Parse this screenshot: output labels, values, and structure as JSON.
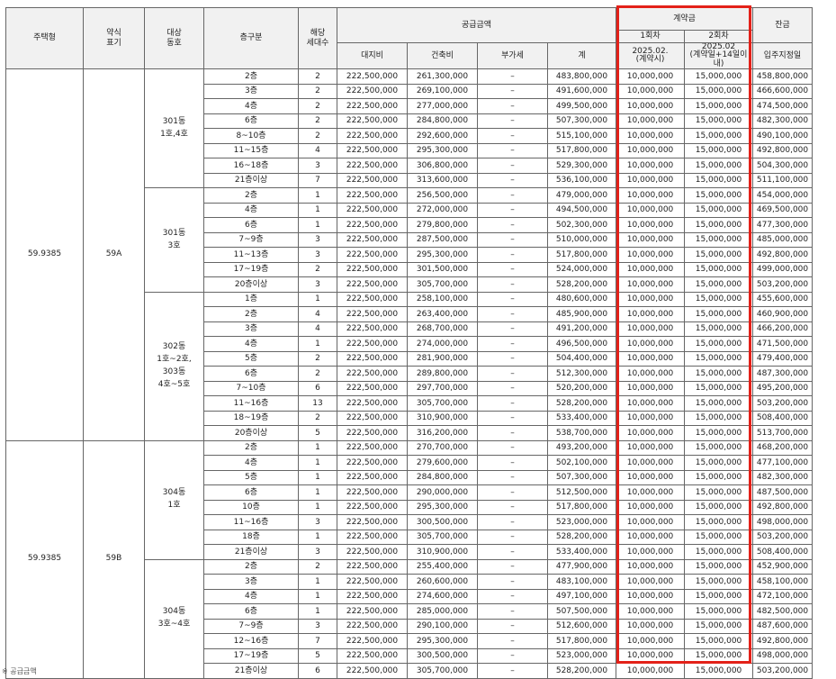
{
  "header": {
    "type": "주택형",
    "short": "약식\n표기",
    "dong": "대상\n동호",
    "floor": "층구분",
    "units": "해당\n세대수",
    "supply_group": "공급금액",
    "land": "대지비",
    "building": "건축비",
    "vat": "부가세",
    "total": "계",
    "deposit_group": "계약금",
    "dep1": "1회차",
    "dep1_date": "2025.02.\n(계약시)",
    "dep2": "2회차",
    "dep2_date": "2025.02\n(계약일+14일이내)",
    "balance": "잔금",
    "balance_date": "입주지정일"
  },
  "groups": [
    {
      "type": "59.9385",
      "short": "59A",
      "blocks": [
        {
          "dong": "301동\n1호,4호",
          "rows": [
            [
              "2층",
              "2",
              "222,500,000",
              "261,300,000",
              "–",
              "483,800,000",
              "10,000,000",
              "15,000,000",
              "458,800,000"
            ],
            [
              "3층",
              "2",
              "222,500,000",
              "269,100,000",
              "–",
              "491,600,000",
              "10,000,000",
              "15,000,000",
              "466,600,000"
            ],
            [
              "4층",
              "2",
              "222,500,000",
              "277,000,000",
              "–",
              "499,500,000",
              "10,000,000",
              "15,000,000",
              "474,500,000"
            ],
            [
              "6층",
              "2",
              "222,500,000",
              "284,800,000",
              "–",
              "507,300,000",
              "10,000,000",
              "15,000,000",
              "482,300,000"
            ],
            [
              "8~10층",
              "2",
              "222,500,000",
              "292,600,000",
              "–",
              "515,100,000",
              "10,000,000",
              "15,000,000",
              "490,100,000"
            ],
            [
              "11~15층",
              "4",
              "222,500,000",
              "295,300,000",
              "–",
              "517,800,000",
              "10,000,000",
              "15,000,000",
              "492,800,000"
            ],
            [
              "16~18층",
              "3",
              "222,500,000",
              "306,800,000",
              "–",
              "529,300,000",
              "10,000,000",
              "15,000,000",
              "504,300,000"
            ],
            [
              "21층이상",
              "7",
              "222,500,000",
              "313,600,000",
              "–",
              "536,100,000",
              "10,000,000",
              "15,000,000",
              "511,100,000"
            ]
          ]
        },
        {
          "dong": "301동\n3호",
          "rows": [
            [
              "2층",
              "1",
              "222,500,000",
              "256,500,000",
              "–",
              "479,000,000",
              "10,000,000",
              "15,000,000",
              "454,000,000"
            ],
            [
              "4층",
              "1",
              "222,500,000",
              "272,000,000",
              "–",
              "494,500,000",
              "10,000,000",
              "15,000,000",
              "469,500,000"
            ],
            [
              "6층",
              "1",
              "222,500,000",
              "279,800,000",
              "–",
              "502,300,000",
              "10,000,000",
              "15,000,000",
              "477,300,000"
            ],
            [
              "7~9층",
              "3",
              "222,500,000",
              "287,500,000",
              "–",
              "510,000,000",
              "10,000,000",
              "15,000,000",
              "485,000,000"
            ],
            [
              "11~13층",
              "3",
              "222,500,000",
              "295,300,000",
              "–",
              "517,800,000",
              "10,000,000",
              "15,000,000",
              "492,800,000"
            ],
            [
              "17~19층",
              "2",
              "222,500,000",
              "301,500,000",
              "–",
              "524,000,000",
              "10,000,000",
              "15,000,000",
              "499,000,000"
            ],
            [
              "20층이상",
              "3",
              "222,500,000",
              "305,700,000",
              "–",
              "528,200,000",
              "10,000,000",
              "15,000,000",
              "503,200,000"
            ]
          ]
        },
        {
          "dong": "302동\n1호~2호,\n303동\n4호~5호",
          "rows": [
            [
              "1층",
              "1",
              "222,500,000",
              "258,100,000",
              "–",
              "480,600,000",
              "10,000,000",
              "15,000,000",
              "455,600,000"
            ],
            [
              "2층",
              "4",
              "222,500,000",
              "263,400,000",
              "–",
              "485,900,000",
              "10,000,000",
              "15,000,000",
              "460,900,000"
            ],
            [
              "3층",
              "4",
              "222,500,000",
              "268,700,000",
              "–",
              "491,200,000",
              "10,000,000",
              "15,000,000",
              "466,200,000"
            ],
            [
              "4층",
              "1",
              "222,500,000",
              "274,000,000",
              "–",
              "496,500,000",
              "10,000,000",
              "15,000,000",
              "471,500,000"
            ],
            [
              "5층",
              "2",
              "222,500,000",
              "281,900,000",
              "–",
              "504,400,000",
              "10,000,000",
              "15,000,000",
              "479,400,000"
            ],
            [
              "6층",
              "2",
              "222,500,000",
              "289,800,000",
              "–",
              "512,300,000",
              "10,000,000",
              "15,000,000",
              "487,300,000"
            ],
            [
              "7~10층",
              "6",
              "222,500,000",
              "297,700,000",
              "–",
              "520,200,000",
              "10,000,000",
              "15,000,000",
              "495,200,000"
            ],
            [
              "11~16층",
              "13",
              "222,500,000",
              "305,700,000",
              "–",
              "528,200,000",
              "10,000,000",
              "15,000,000",
              "503,200,000"
            ],
            [
              "18~19층",
              "2",
              "222,500,000",
              "310,900,000",
              "–",
              "533,400,000",
              "10,000,000",
              "15,000,000",
              "508,400,000"
            ],
            [
              "20층이상",
              "5",
              "222,500,000",
              "316,200,000",
              "–",
              "538,700,000",
              "10,000,000",
              "15,000,000",
              "513,700,000"
            ]
          ]
        }
      ]
    },
    {
      "type": "59.9385",
      "short": "59B",
      "blocks": [
        {
          "dong": "304동\n1호",
          "rows": [
            [
              "2층",
              "1",
              "222,500,000",
              "270,700,000",
              "–",
              "493,200,000",
              "10,000,000",
              "15,000,000",
              "468,200,000"
            ],
            [
              "4층",
              "1",
              "222,500,000",
              "279,600,000",
              "–",
              "502,100,000",
              "10,000,000",
              "15,000,000",
              "477,100,000"
            ],
            [
              "5층",
              "1",
              "222,500,000",
              "284,800,000",
              "–",
              "507,300,000",
              "10,000,000",
              "15,000,000",
              "482,300,000"
            ],
            [
              "6층",
              "1",
              "222,500,000",
              "290,000,000",
              "–",
              "512,500,000",
              "10,000,000",
              "15,000,000",
              "487,500,000"
            ],
            [
              "10층",
              "1",
              "222,500,000",
              "295,300,000",
              "–",
              "517,800,000",
              "10,000,000",
              "15,000,000",
              "492,800,000"
            ],
            [
              "11~16층",
              "3",
              "222,500,000",
              "300,500,000",
              "–",
              "523,000,000",
              "10,000,000",
              "15,000,000",
              "498,000,000"
            ],
            [
              "18층",
              "1",
              "222,500,000",
              "305,700,000",
              "–",
              "528,200,000",
              "10,000,000",
              "15,000,000",
              "503,200,000"
            ],
            [
              "21층이상",
              "3",
              "222,500,000",
              "310,900,000",
              "–",
              "533,400,000",
              "10,000,000",
              "15,000,000",
              "508,400,000"
            ]
          ]
        },
        {
          "dong": "304동\n3호~4호",
          "rows": [
            [
              "2층",
              "2",
              "222,500,000",
              "255,400,000",
              "–",
              "477,900,000",
              "10,000,000",
              "15,000,000",
              "452,900,000"
            ],
            [
              "3층",
              "1",
              "222,500,000",
              "260,600,000",
              "–",
              "483,100,000",
              "10,000,000",
              "15,000,000",
              "458,100,000"
            ],
            [
              "4층",
              "1",
              "222,500,000",
              "274,600,000",
              "–",
              "497,100,000",
              "10,000,000",
              "15,000,000",
              "472,100,000"
            ],
            [
              "6층",
              "1",
              "222,500,000",
              "285,000,000",
              "–",
              "507,500,000",
              "10,000,000",
              "15,000,000",
              "482,500,000"
            ],
            [
              "7~9층",
              "3",
              "222,500,000",
              "290,100,000",
              "–",
              "512,600,000",
              "10,000,000",
              "15,000,000",
              "487,600,000"
            ],
            [
              "12~16층",
              "7",
              "222,500,000",
              "295,300,000",
              "–",
              "517,800,000",
              "10,000,000",
              "15,000,000",
              "492,800,000"
            ],
            [
              "17~19층",
              "5",
              "222,500,000",
              "300,500,000",
              "–",
              "523,000,000",
              "10,000,000",
              "15,000,000",
              "498,000,000"
            ],
            [
              "21층이상",
              "6",
              "222,500,000",
              "305,700,000",
              "–",
              "528,200,000",
              "10,000,000",
              "15,000,000",
              "503,200,000"
            ]
          ]
        }
      ]
    }
  ],
  "footnote": "※ 공급금액",
  "highlight_color": "#e32119"
}
